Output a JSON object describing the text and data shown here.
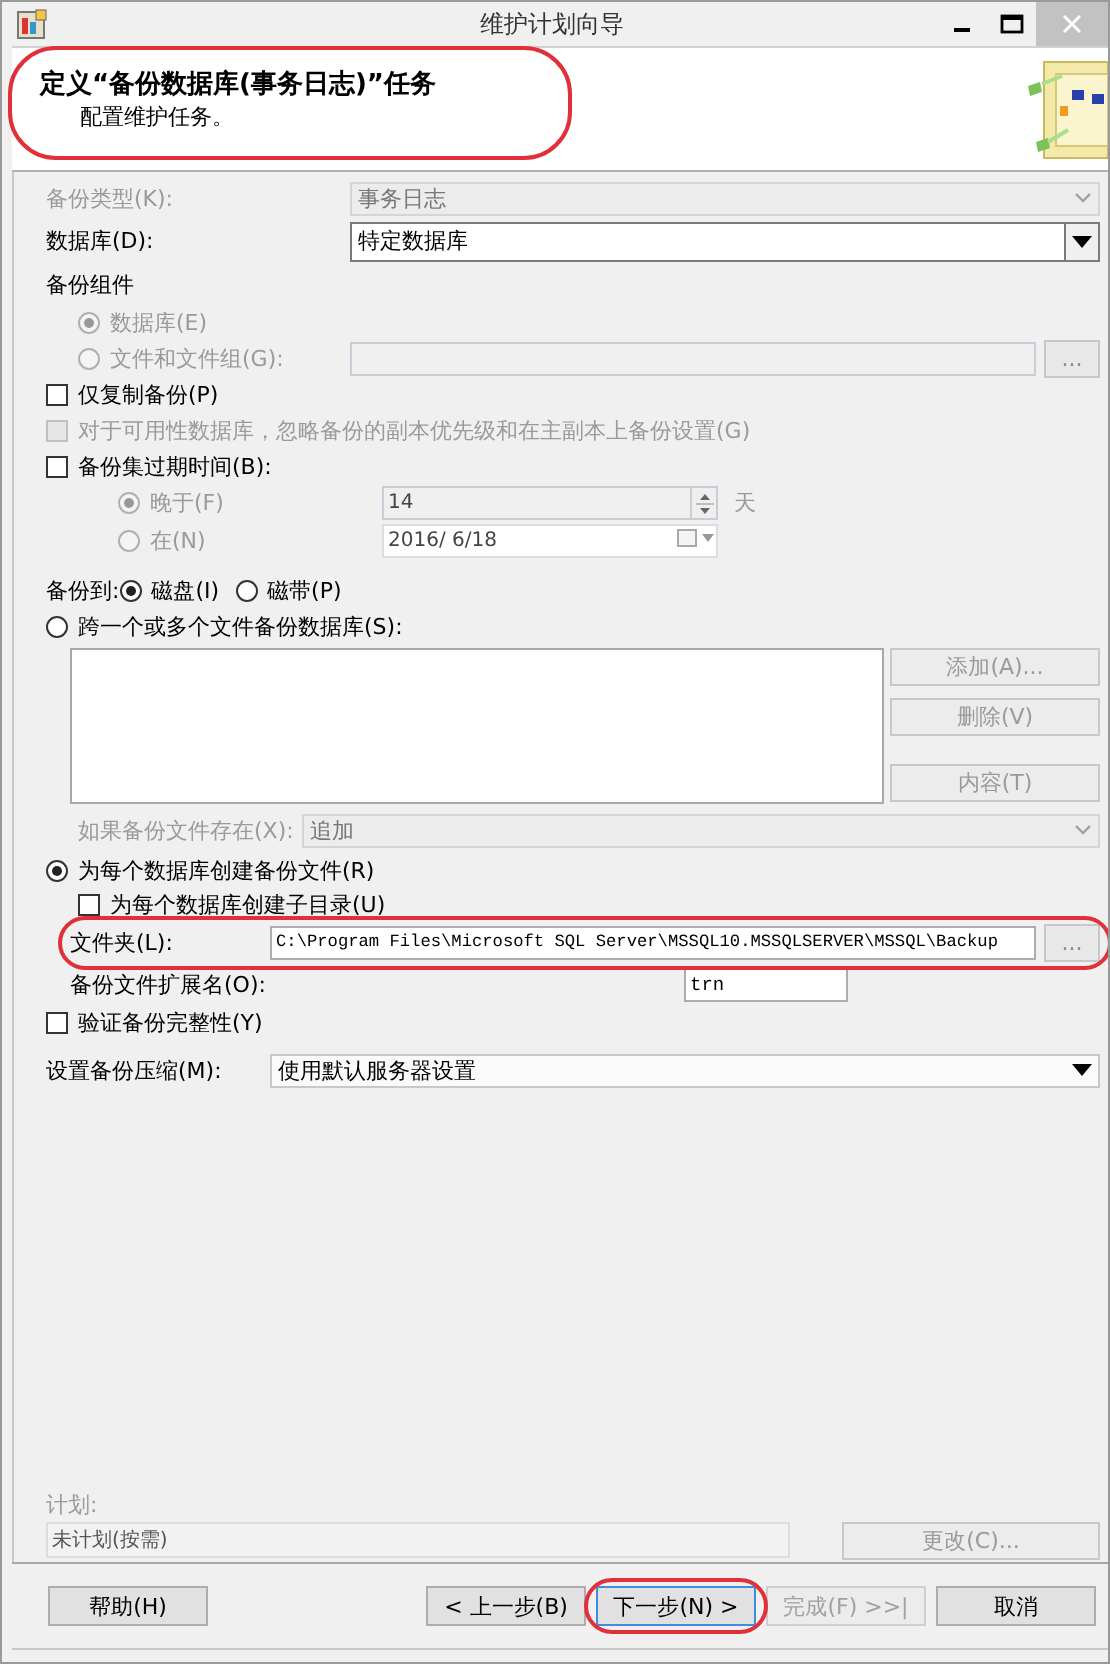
{
  "window": {
    "title": "维护计划向导"
  },
  "header": {
    "title": "定义“备份数据库(事务日志)”任务",
    "subtitle": "配置维护任务。",
    "highlighted": true
  },
  "backup_type": {
    "label": "备份类型(K):",
    "value": "事务日志",
    "disabled": true
  },
  "database": {
    "label": "数据库(D):",
    "value": "特定数据库",
    "disabled": false
  },
  "components": {
    "label": "备份组件",
    "disabled": true,
    "options": [
      {
        "label": "数据库(E)",
        "selected": true
      },
      {
        "label": "文件和文件组(G):",
        "selected": false
      }
    ],
    "browse": "..."
  },
  "copy_only": {
    "label": "仅复制备份(P)",
    "checked": false,
    "disabled": false
  },
  "ignore_replica": {
    "label": "对于可用性数据库，忽略备份的副本优先级和在主副本上备份设置(G)",
    "checked": false,
    "disabled": true
  },
  "expire": {
    "label": "备份集过期时间(B):",
    "checked": false,
    "options": [
      {
        "label": "晚于(F)",
        "selected": true,
        "value": "14",
        "unit": "天",
        "kind": "days"
      },
      {
        "label": "在(N)",
        "selected": false,
        "value": "2016/ 6/18",
        "kind": "date"
      }
    ]
  },
  "backup_to": {
    "label": "备份到:",
    "options": [
      {
        "label": "磁盘(I)",
        "selected": true
      },
      {
        "label": "磁带(P)",
        "selected": false
      }
    ]
  },
  "span_files": {
    "label": "跨一个或多个文件备份数据库(S):",
    "selected": false,
    "buttons": [
      {
        "label": "添加(A)..."
      },
      {
        "label": "删除(V)"
      },
      {
        "label": "内容(T)"
      }
    ],
    "if_exists": {
      "label": "如果备份文件存在(X):",
      "value": "追加"
    }
  },
  "per_database": {
    "label": "为每个数据库创建备份文件(R)",
    "selected": true,
    "subdir": {
      "label": "为每个数据库创建子目录(U)",
      "checked": false
    },
    "folder": {
      "label": "文件夹(L):",
      "value": "C:\\Program Files\\Microsoft SQL Server\\MSSQL10.MSSQLSERVER\\MSSQL\\Backup",
      "browse": "...",
      "highlighted": true
    },
    "extension": {
      "label": "备份文件扩展名(O):",
      "value": "trn"
    }
  },
  "verify": {
    "label": "验证备份完整性(Y)",
    "checked": false
  },
  "compression": {
    "label": "设置备份压缩(M):",
    "value": "使用默认服务器设置"
  },
  "schedule": {
    "label": "计划:",
    "value": "未计划(按需)",
    "button": "更改(C)...",
    "disabled": true
  },
  "buttons": [
    {
      "label": "帮助(H)",
      "disabled": false,
      "highlighted": false,
      "kind": "left"
    },
    {
      "label": "< 上一步(B)",
      "disabled": false,
      "highlighted": false,
      "kind": "right"
    },
    {
      "label": "下一步(N) >",
      "disabled": false,
      "highlighted": true,
      "kind": "right"
    },
    {
      "label": "完成(F) >>|",
      "disabled": true,
      "highlighted": false,
      "kind": "right"
    },
    {
      "label": "取消",
      "disabled": false,
      "highlighted": false,
      "kind": "right"
    }
  ]
}
